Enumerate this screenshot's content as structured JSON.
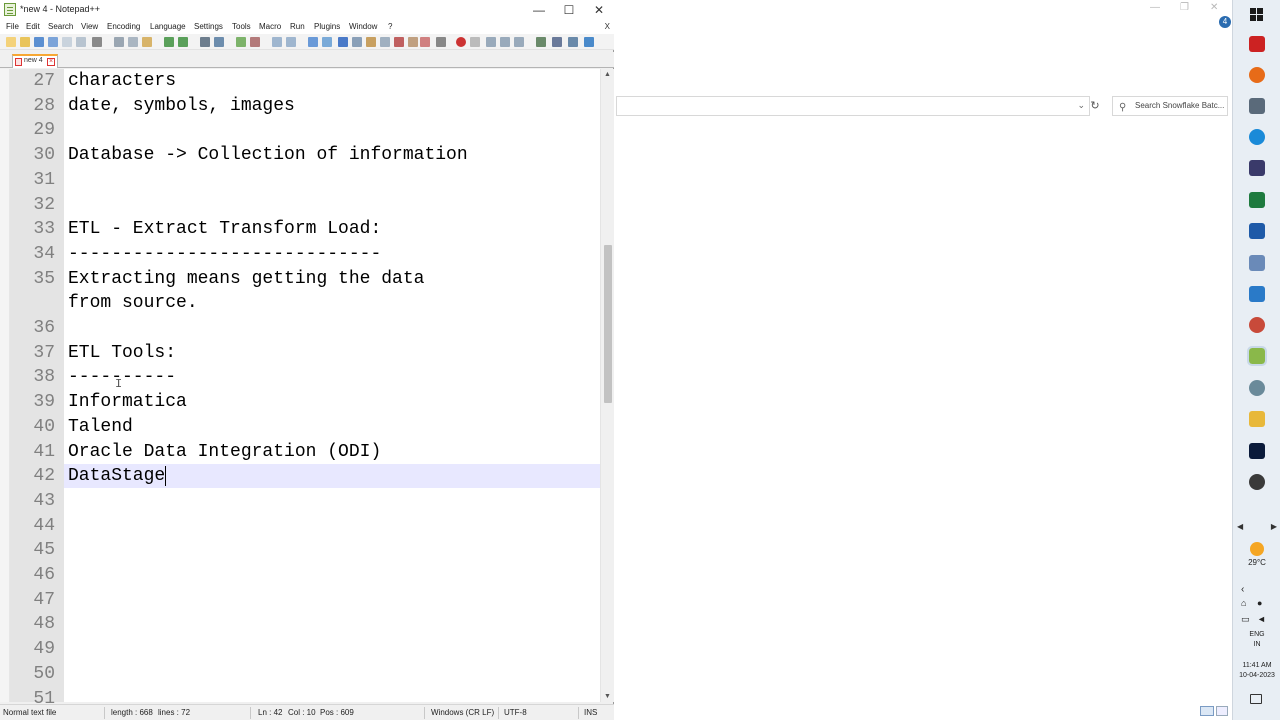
{
  "window": {
    "title": "*new 4 - Notepad++",
    "minimize": "—",
    "maximize": "☐",
    "close": "✕"
  },
  "menu": {
    "items": [
      "File",
      "Edit",
      "Search",
      "View",
      "Encoding",
      "Language",
      "Settings",
      "Tools",
      "Macro",
      "Run",
      "Plugins",
      "Window",
      "?"
    ],
    "close_doc": "X"
  },
  "tabs": [
    {
      "label": "new 4",
      "active": true,
      "modified": true
    }
  ],
  "editor": {
    "lines": [
      {
        "num": "27",
        "text": "characters"
      },
      {
        "num": "28",
        "text": "date, symbols, images"
      },
      {
        "num": "29",
        "text": ""
      },
      {
        "num": "30",
        "text": "Database -> Collection of information"
      },
      {
        "num": "31",
        "text": ""
      },
      {
        "num": "32",
        "text": ""
      },
      {
        "num": "33",
        "text": "ETL - Extract Transform Load:"
      },
      {
        "num": "34",
        "text": "-----------------------------"
      },
      {
        "num": "35",
        "text": "Extracting means getting the data"
      },
      {
        "num": "",
        "text": "from source."
      },
      {
        "num": "36",
        "text": ""
      },
      {
        "num": "37",
        "text": "ETL Tools:"
      },
      {
        "num": "38",
        "text": "----------"
      },
      {
        "num": "39",
        "text": "Informatica"
      },
      {
        "num": "40",
        "text": "Talend"
      },
      {
        "num": "41",
        "text": "Oracle Data Integration (ODI)"
      },
      {
        "num": "42",
        "text": "DataStage"
      },
      {
        "num": "43",
        "text": ""
      },
      {
        "num": "44",
        "text": ""
      },
      {
        "num": "45",
        "text": ""
      },
      {
        "num": "46",
        "text": ""
      },
      {
        "num": "47",
        "text": ""
      },
      {
        "num": "48",
        "text": ""
      },
      {
        "num": "49",
        "text": ""
      },
      {
        "num": "50",
        "text": ""
      },
      {
        "num": "51",
        "text": ""
      }
    ],
    "current_line": "42",
    "colors": {
      "current_line_bg": "#e8e8ff",
      "gutter_bg": "#e4e4e4",
      "line_number": "#808080"
    }
  },
  "statusbar": {
    "file_type": "Normal text file",
    "length": "length : 668",
    "lines": "lines : 72",
    "ln": "Ln : 42",
    "col": "Col : 10",
    "pos": "Pos : 609",
    "eol": "Windows (CR LF)",
    "encoding": "UTF-8",
    "mode": "INS"
  },
  "background_window": {
    "search_placeholder": "Search Snowflake Batc...",
    "minimize": "—",
    "maximize": "❐",
    "close": "✕"
  },
  "taskbar": {
    "temperature": "29°C",
    "lang_line1": "ENG",
    "lang_line2": "IN",
    "time": "11:41 AM",
    "date": "10-04-2023",
    "notification_count": "4",
    "icons": [
      "store-icon",
      "firefox-icon",
      "window-app-icon",
      "edge-icon",
      "terminal-icon",
      "excel-icon",
      "word-icon",
      "onenote-icon",
      "remote-desktop-icon",
      "snip-icon",
      "notepadpp-icon",
      "gear-app-icon",
      "file-explorer-icon",
      "photoshop-icon",
      "chrome-icon"
    ]
  }
}
